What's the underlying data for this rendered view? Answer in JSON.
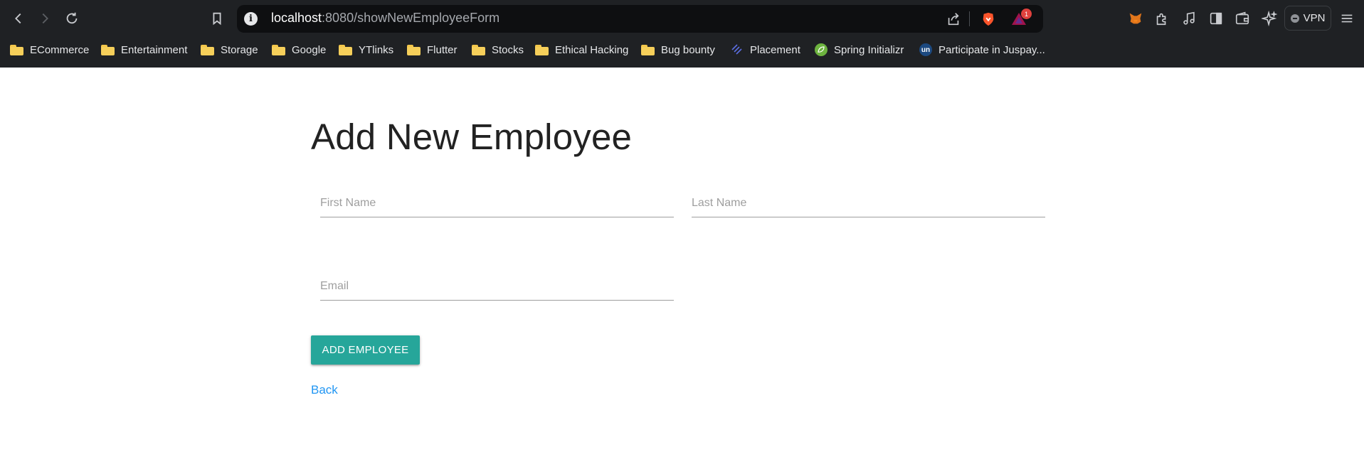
{
  "browser": {
    "url_host": "localhost",
    "url_rest": ":8080/showNewEmployeeForm",
    "brave_badge": "1",
    "vpn_label": "VPN",
    "bookmarks": [
      {
        "label": "ECommerce",
        "icon": "folder-icon"
      },
      {
        "label": "Entertainment",
        "icon": "folder-icon"
      },
      {
        "label": "Storage",
        "icon": "folder-icon"
      },
      {
        "label": "Google",
        "icon": "folder-icon"
      },
      {
        "label": "YTlinks",
        "icon": "folder-icon"
      },
      {
        "label": "Flutter",
        "icon": "folder-icon"
      },
      {
        "label": "Stocks",
        "icon": "folder-icon"
      },
      {
        "label": "Ethical Hacking",
        "icon": "folder-icon"
      },
      {
        "label": "Bug bounty",
        "icon": "folder-icon"
      },
      {
        "label": "Placement",
        "icon": "placement-favicon"
      },
      {
        "label": "Spring Initializr",
        "icon": "spring-favicon"
      },
      {
        "label": "Participate in Juspay...",
        "icon": "unstop-favicon",
        "icon_text": "un"
      }
    ]
  },
  "page": {
    "title": "Add New Employee",
    "first_name_placeholder": "First Name",
    "last_name_placeholder": "Last Name",
    "email_placeholder": "Email",
    "submit_label": "ADD EMPLOYEE",
    "back_label": "Back"
  },
  "colors": {
    "button": "#26a69a",
    "link": "#2196f3",
    "chrome": "#1f2124"
  }
}
